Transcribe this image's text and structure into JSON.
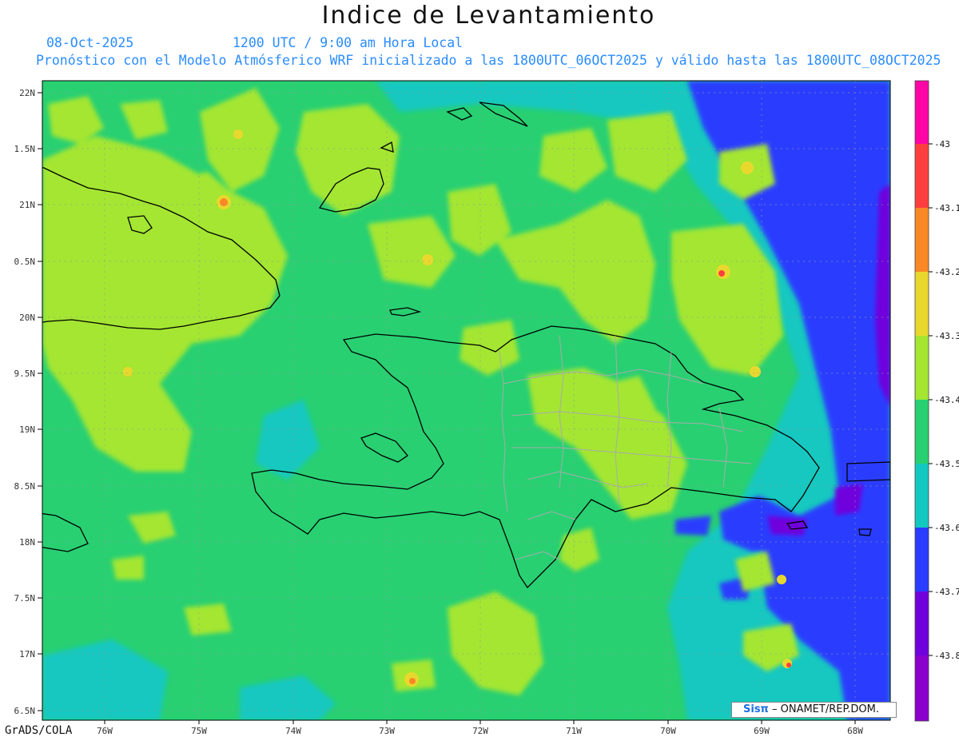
{
  "header": {
    "title": "Indice de Levantamiento",
    "date": "08-Oct-2025",
    "time": "1200 UTC / 9:00 am Hora Local",
    "description": "Pronóstico con el Modelo Atmósferico WRF inicializado a las 1800UTC_06OCT2025 y válido hasta las  1800UTC_08OCT2025"
  },
  "map": {
    "lat_labels": [
      "22N",
      "1.5N",
      "21N",
      "0.5N",
      "20N",
      "9.5N",
      "19N",
      "8.5N",
      "18N",
      "7.5N",
      "17N",
      "6.5N"
    ],
    "lon_labels": [
      "76W",
      "75W",
      "74W",
      "73W",
      "72W",
      "71W",
      "70W",
      "69W",
      "68W"
    ],
    "colors": {
      "background_field": "#28d072",
      "light_green": "#a4e632",
      "cyan": "#12c8c0",
      "blue": "#2a3cff",
      "purple": "#7000dc"
    }
  },
  "colorbar": {
    "labels": [
      "-43",
      "-43.1",
      "-43.2",
      "-43.3",
      "-43.4",
      "-43.5",
      "-43.6",
      "-43.7",
      "-43.8"
    ],
    "colors": [
      "#fe05a5",
      "#fd3e3e",
      "#f98826",
      "#e8d82e",
      "#a4e632",
      "#28d072",
      "#12c8c0",
      "#2a3cff",
      "#7000dc",
      "#8b00cc"
    ]
  },
  "footer": {
    "credit": "GrADS/COLA",
    "logo_brand": "Sisπ",
    "logo_text": "– ONAMET/REP.DOM."
  }
}
